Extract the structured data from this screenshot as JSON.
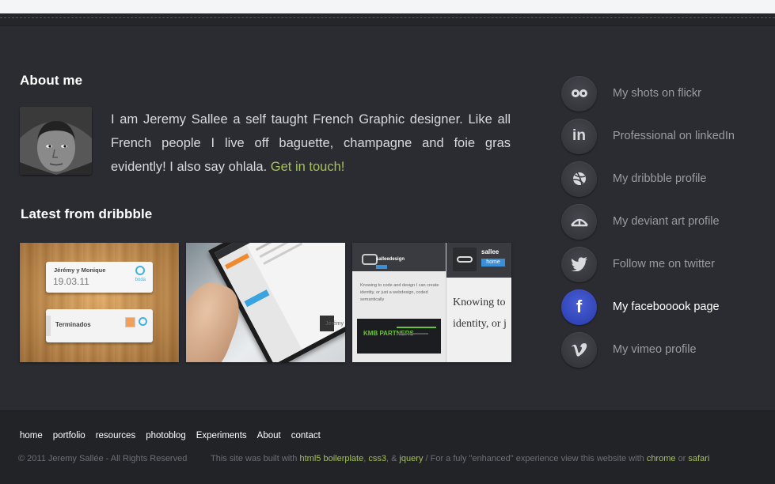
{
  "about": {
    "heading": "About me",
    "text": "I am Jeremy Sallee a self taught French Graphic designer. Like all French people I live off baguette, champagne and foie gras evidently! I also say ohlala.",
    "link": "Get in touch!"
  },
  "dribbble": {
    "heading": "Latest from dribbble",
    "shots": [
      {
        "line1": "Jérémy y Monique",
        "line2": "19.03.11",
        "line3": "Terminados",
        "badge": "boda"
      },
      {
        "caption": "Jérémy"
      },
      {
        "brand": "salleedesign",
        "brand2": "sallee",
        "button": "home",
        "text1": "Knowing to code and design I can create",
        "text2": "identity, or just a webdesign, coded semantically",
        "big1": "Knowing to",
        "big2": "identity, or j",
        "logo": "KMB PARTNERS"
      }
    ]
  },
  "social": [
    {
      "label": "My shots on flickr",
      "icon": "flickr-icon"
    },
    {
      "label": "Professional on linkedIn",
      "icon": "linkedin-icon",
      "glyph": "in"
    },
    {
      "label": "My dribbble profile",
      "icon": "dribbble-icon"
    },
    {
      "label": "My deviant art profile",
      "icon": "deviantart-icon"
    },
    {
      "label": "Follow me on twitter",
      "icon": "twitter-icon"
    },
    {
      "label": "My facebooook page",
      "icon": "facebook-icon",
      "glyph": "f",
      "active": true
    },
    {
      "label": "My vimeo profile",
      "icon": "vimeo-icon"
    }
  ],
  "footer": {
    "nav": [
      "home",
      "portfolio",
      "resources",
      "photoblog",
      "Experiments",
      "About",
      "contact"
    ],
    "copyright": "© 2011 Jeremy Sallée - All Rights Reserved",
    "built_prefix": "This site was built with",
    "link_html5": "html5 boilerplate",
    "sep1": ",",
    "link_css3": "css3",
    "sep2": ", &",
    "link_jquery": "jquery",
    "built_middle": "/ For a fuly \"enhanced\" experience view this website with",
    "link_chrome": "chrome",
    "or": "or",
    "link_safari": "safari"
  },
  "colors": {
    "accent": "#a4c15a",
    "facebook": "#3145b8",
    "background": "#2b2c32"
  }
}
